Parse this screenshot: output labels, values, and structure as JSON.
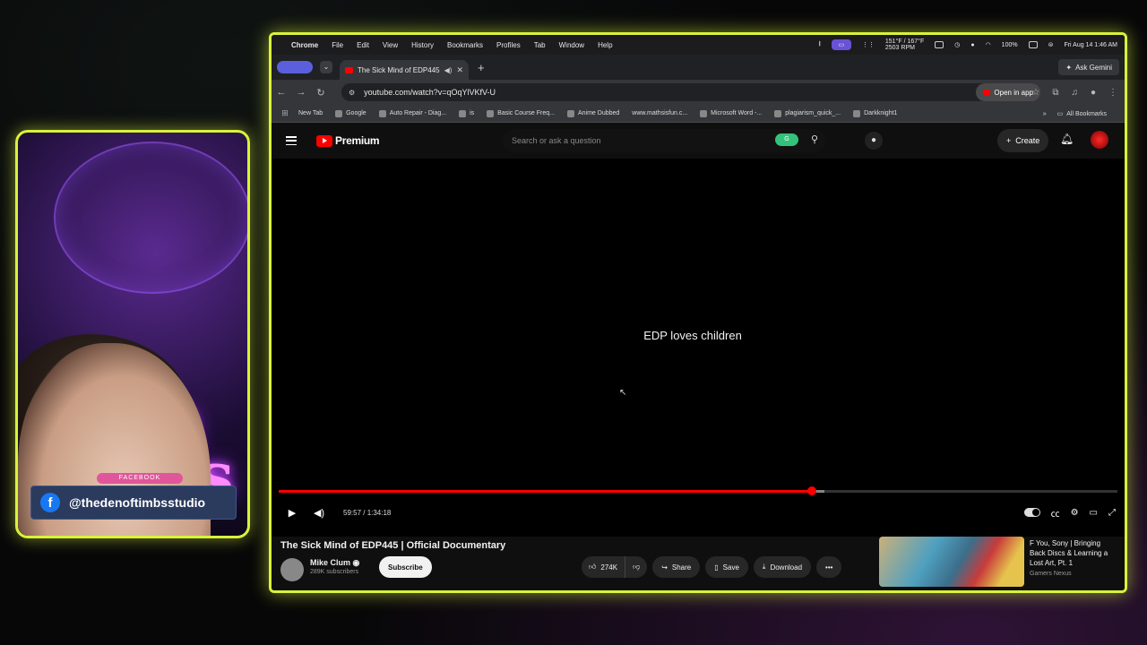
{
  "overlay": {
    "facebook_label": "FACEBOOK",
    "facebook_handle": "@thedenoftimbsstudio",
    "neon_text_1": "n",
    "neon_text_2": "bs"
  },
  "menubar": {
    "app": "Chrome",
    "items": [
      "File",
      "Edit",
      "View",
      "History",
      "Bookmarks",
      "Profiles",
      "Tab",
      "Window",
      "Help"
    ],
    "temp": "151°F / 167°F",
    "rpm": "2503 RPM",
    "battery": "100%",
    "datetime": "Fri Aug 14  1:46 AM"
  },
  "tabs": [
    {
      "title": "The Sick Mind of EDP445",
      "active": true
    }
  ],
  "ask_gemini": "Ask Gemini",
  "address_bar": {
    "url": "youtube.com/watch?v=qOqYlVKfV-U",
    "open_in_app": "Open in app"
  },
  "bookmarks": {
    "items": [
      "New Tab",
      "Google",
      "Auto Repair - Diag...",
      "is",
      "Basic Course Freq...",
      "Anime Dubbed",
      "www.mathsisfun.c...",
      "Microsoft Word -...",
      "plagiarism_quick_...",
      "Darkknight1"
    ],
    "all": "All Bookmarks"
  },
  "youtube": {
    "brand": "Premium",
    "search_placeholder": "Search or ask a question",
    "create_label": "Create",
    "player": {
      "caption": "EDP loves children",
      "time": "59:57 / 1:34:18",
      "progress": 0.636
    },
    "video": {
      "title": "The Sick Mind of EDP445 | Official Documentary",
      "channel": "Mike Clum",
      "subscribers": "289K subscribers",
      "subscribe_label": "Subscribe",
      "likes": "274K",
      "share_label": "Share",
      "save_label": "Save",
      "download_label": "Download"
    },
    "recommended": {
      "title": "F You, Sony | Bringing Back Discs & Learning a Lost Art, Pt. 1",
      "channel": "Gamers Nexus"
    }
  },
  "colors": {
    "frame_accent": "#d9f23b",
    "youtube_red": "#ff0000",
    "neon_purple": "#d64bff"
  }
}
